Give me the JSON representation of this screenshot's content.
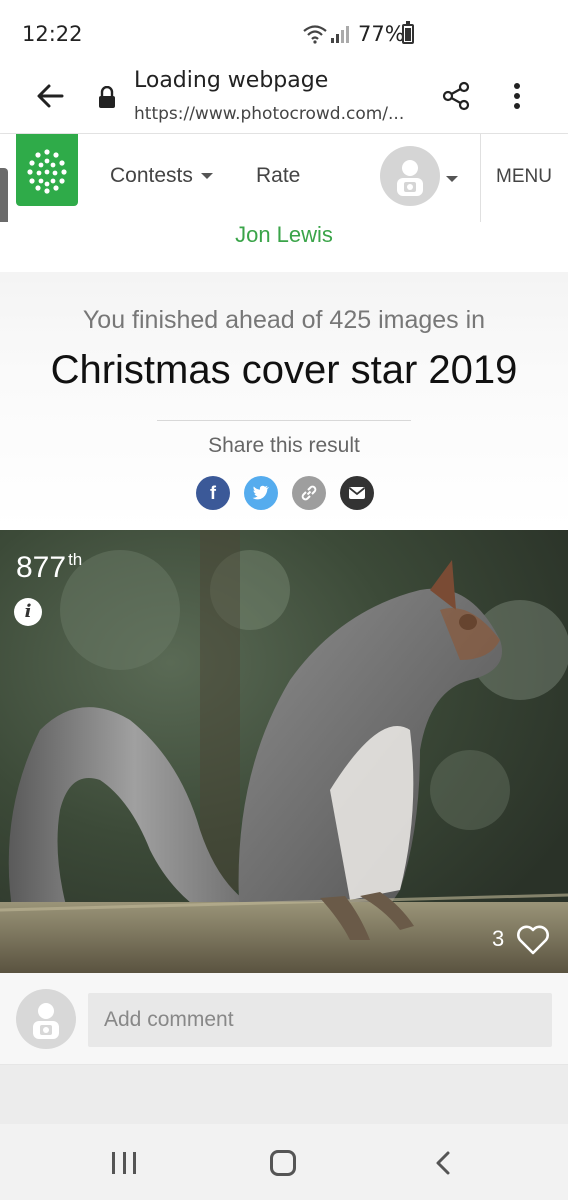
{
  "status_bar": {
    "time": "12:22",
    "battery": "77%"
  },
  "browser": {
    "title": "Loading webpage",
    "url": "https://www.photocrowd.com/..."
  },
  "site_nav": {
    "contests_label": "Contests",
    "rate_label": "Rate",
    "menu_label": "MENU",
    "brand_color": "#2fab49"
  },
  "author": {
    "name": "Jon Lewis"
  },
  "result": {
    "lead": "You finished ahead of 425 images in",
    "contest_title": "Christmas cover star 2019",
    "share_label": "Share this result",
    "social": [
      {
        "icon": "facebook-icon",
        "glyph": "f",
        "color": "#3b5998"
      },
      {
        "icon": "twitter-icon",
        "glyph": "t",
        "color": "#55acee"
      },
      {
        "icon": "link-icon",
        "glyph": "🔗",
        "color": "#9e9e9e"
      },
      {
        "icon": "email-icon",
        "glyph": "✉",
        "color": "#333333"
      }
    ]
  },
  "photo": {
    "rank_number": "877",
    "rank_suffix": "th",
    "likes": "3"
  },
  "comment": {
    "placeholder": "Add comment"
  }
}
